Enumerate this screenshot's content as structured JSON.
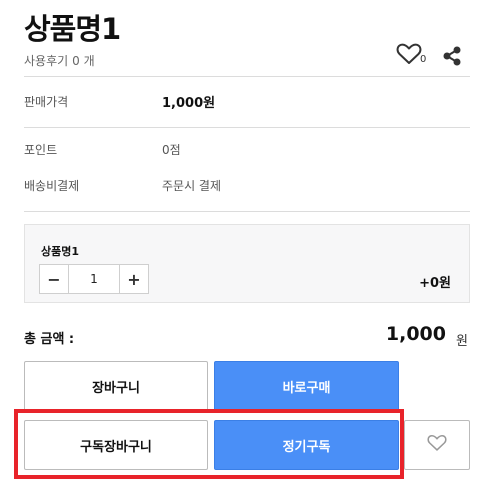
{
  "product": {
    "title": "상품명1",
    "review_label": "사용후기",
    "review_count": "0 개",
    "wish_count": "0"
  },
  "info": {
    "price_label": "판매가격",
    "price_value": "1,000원",
    "point_label": "포인트",
    "point_value": "0점",
    "shipping_label": "배송비결제",
    "shipping_value": "주문시 결제"
  },
  "option": {
    "name": "상품명1",
    "minus": "−",
    "quantity": "1",
    "plus": "+",
    "price": "+0원"
  },
  "total": {
    "label": "총 금액 :",
    "amount": "1,000",
    "unit": "원"
  },
  "buttons": {
    "cart": "장바구니",
    "buy_now": "바로구매",
    "subscribe_cart": "구독장바구니",
    "subscribe": "정기구독"
  },
  "colors": {
    "accent_blue": "#4a8ff7",
    "highlight_red": "#e8232a"
  },
  "icons": {
    "wish": "heart-outline-icon",
    "share": "share-icon"
  }
}
